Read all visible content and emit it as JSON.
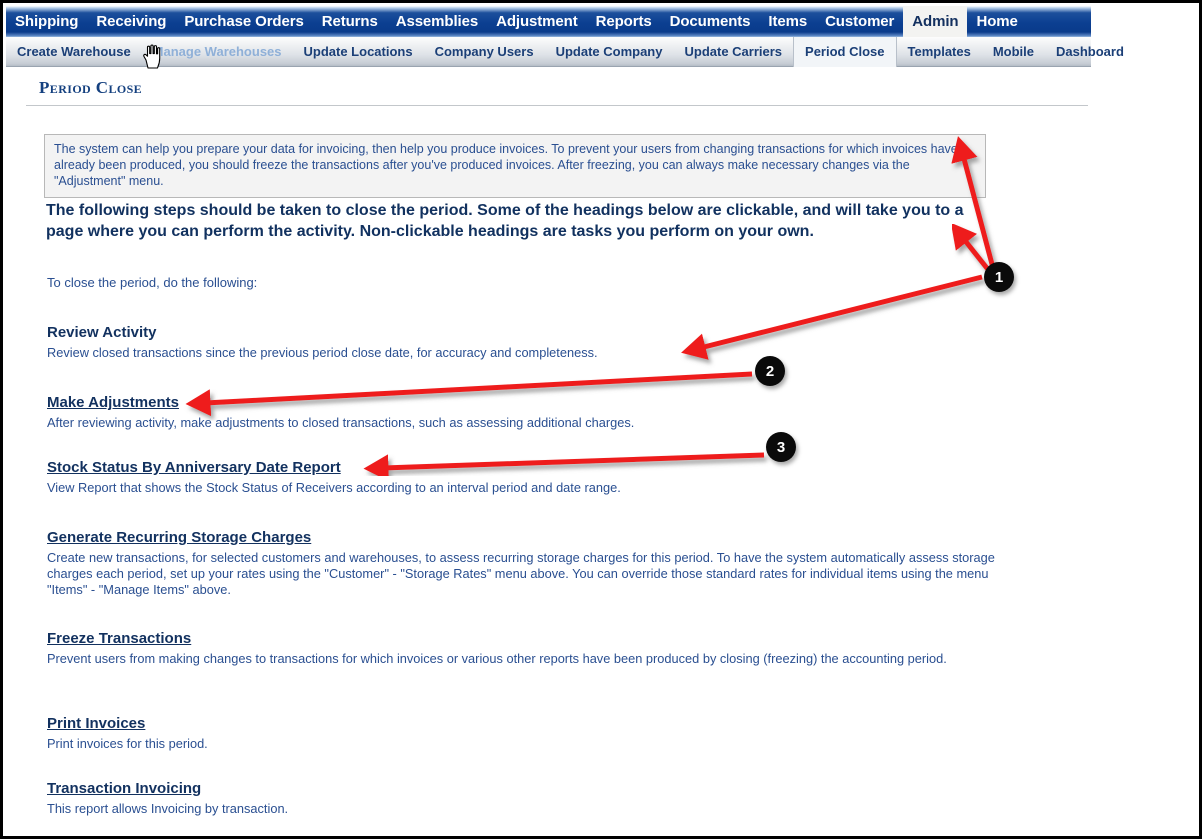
{
  "window": {
    "title": "Period Close"
  },
  "primary_nav": {
    "items": [
      {
        "label": "Shipping",
        "active": false
      },
      {
        "label": "Receiving",
        "active": false
      },
      {
        "label": "Purchase Orders",
        "active": false
      },
      {
        "label": "Returns",
        "active": false
      },
      {
        "label": "Assemblies",
        "active": false
      },
      {
        "label": "Adjustment",
        "active": false
      },
      {
        "label": "Reports",
        "active": false
      },
      {
        "label": "Documents",
        "active": false
      },
      {
        "label": "Items",
        "active": false
      },
      {
        "label": "Customer",
        "active": false
      },
      {
        "label": "Admin",
        "active": true
      },
      {
        "label": "Home",
        "active": false
      }
    ]
  },
  "secondary_nav": {
    "items": [
      {
        "label": "Create Warehouse",
        "state": "normal"
      },
      {
        "label": "Manage Warehouses",
        "state": "hover"
      },
      {
        "label": "Update Locations",
        "state": "normal"
      },
      {
        "label": "Company Users",
        "state": "normal"
      },
      {
        "label": "Update Company",
        "state": "normal"
      },
      {
        "label": "Update Carriers",
        "state": "normal"
      },
      {
        "label": "Period Close",
        "state": "active"
      },
      {
        "label": "Templates",
        "state": "normal"
      },
      {
        "label": "Mobile",
        "state": "normal"
      },
      {
        "label": "Dashboard",
        "state": "normal"
      }
    ]
  },
  "page": {
    "title": "Period Close",
    "info_box": "The system can help you prepare your data for invoicing, then help you produce invoices. To prevent your users from changing transactions for which invoices have already been produced, you should freeze the transactions after you've produced invoices. After freezing, you can always make necessary changes via the \"Adjustment\" menu.",
    "steps_intro": "The following steps should be taken to close the period. Some of the headings below are clickable, and will take you to a page where you can perform the activity. Non-clickable headings are tasks you perform on your own.",
    "do_following": "To close the period, do the following:",
    "sections": [
      {
        "heading": "Review Activity",
        "clickable": false,
        "description": "Review closed transactions since the previous period close date, for accuracy and completeness."
      },
      {
        "heading": "Make Adjustments",
        "clickable": true,
        "description": "After reviewing activity, make adjustments to closed transactions, such as assessing additional charges."
      },
      {
        "heading": "Stock Status By Anniversary Date Report",
        "clickable": true,
        "description": "View Report that shows the Stock Status of Receivers according to an interval period and date range."
      },
      {
        "heading": "Generate Recurring Storage Charges",
        "clickable": true,
        "description": "Create new transactions, for selected customers and warehouses, to assess recurring storage charges for this period. To have the system automatically assess storage charges each period, set up your rates using the \"Customer\" - \"Storage Rates\" menu above. You can override those standard rates for individual items using the menu \"Items\" - \"Manage Items\" above."
      },
      {
        "heading": "Freeze Transactions",
        "clickable": true,
        "description": "Prevent users from making changes to transactions for which invoices or various other reports have been produced by closing (freezing) the accounting period."
      },
      {
        "heading": "Print Invoices",
        "clickable": true,
        "description": "Print invoices for this period."
      },
      {
        "heading": "Transaction Invoicing",
        "clickable": true,
        "description": "This report allows Invoicing by transaction."
      }
    ]
  },
  "annotations": {
    "arrow_color": "#ee1c1c",
    "badge_color": "#0a0a0a",
    "badges": [
      {
        "number": "1",
        "target": "info-box-and-steps-intro"
      },
      {
        "number": "2",
        "target": "review-activity-description"
      },
      {
        "number": "3",
        "target": "stock-status-by-anniversary-date-report-heading"
      }
    ]
  },
  "cursor": {
    "icon": "pointing-hand-cursor",
    "over": "Manage Warehouses"
  }
}
